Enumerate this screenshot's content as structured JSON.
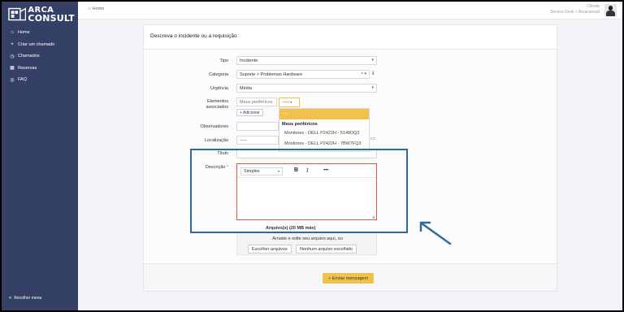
{
  "brand": {
    "line1": "ARCA",
    "line2": "CONSULT"
  },
  "sidebar": {
    "items": [
      {
        "icon": "home-icon",
        "glyph": "⌂",
        "label": "Home"
      },
      {
        "icon": "plus-icon",
        "glyph": "+",
        "label": "Criar um chamado"
      },
      {
        "icon": "clock-icon",
        "glyph": "◷",
        "label": "Chamados"
      },
      {
        "icon": "calendar-icon",
        "glyph": "▦",
        "label": "Reservas"
      },
      {
        "icon": "faq-icon",
        "glyph": "◎",
        "label": "FAQ"
      }
    ],
    "collapse_label": "Recolher menu"
  },
  "topbar": {
    "breadcrumb": "Home",
    "user_name": "Cliente",
    "user_context": "Service Desk > Arcaconsult"
  },
  "card": {
    "title": "Descreva o incidente ou a requisição"
  },
  "form": {
    "tipo": {
      "label": "Tipo",
      "value": "Incidente"
    },
    "categoria": {
      "label": "Categoria",
      "value": "Suporte > Problemas Hardware"
    },
    "urgencia": {
      "label": "Urgência",
      "value": "Média"
    },
    "elementos": {
      "label_line1": "Elementos",
      "label_line2": "associados",
      "pill": "Meus periféricos",
      "select_value": "-----",
      "add_label": "+ Adicionar"
    },
    "dropdown": {
      "selected": "-----",
      "group": "Meus periféricos",
      "options": [
        "Monitores - DELL P2422H - 5148DQ3",
        "Monitores - DELL P2422H - 7BW7FQ3"
      ]
    },
    "observadores": {
      "label": "Observadores"
    },
    "localizacao": {
      "label": "Localização",
      "value": "-----"
    },
    "titulo": {
      "label": "Título",
      "value": ""
    },
    "descricao": {
      "label": "Descrição",
      "required_mark": "*",
      "format_value": "Simples",
      "bold": "B",
      "italic": "I",
      "more": "•••"
    },
    "arquivos": {
      "label": "Arquivo(s) (20 MB máx)",
      "drop_text": "Arraste e solte seu arquivo aqui, ou",
      "choose_label": "Escolher arquivos",
      "none_label": "Nenhum arquivo escolhido"
    }
  },
  "submit": {
    "label": "+ Enviar mensagem"
  },
  "colors": {
    "sidebar": "#344066",
    "accent": "#f2c14a",
    "annotation": "#2f6b9a",
    "error": "#e2564a"
  }
}
